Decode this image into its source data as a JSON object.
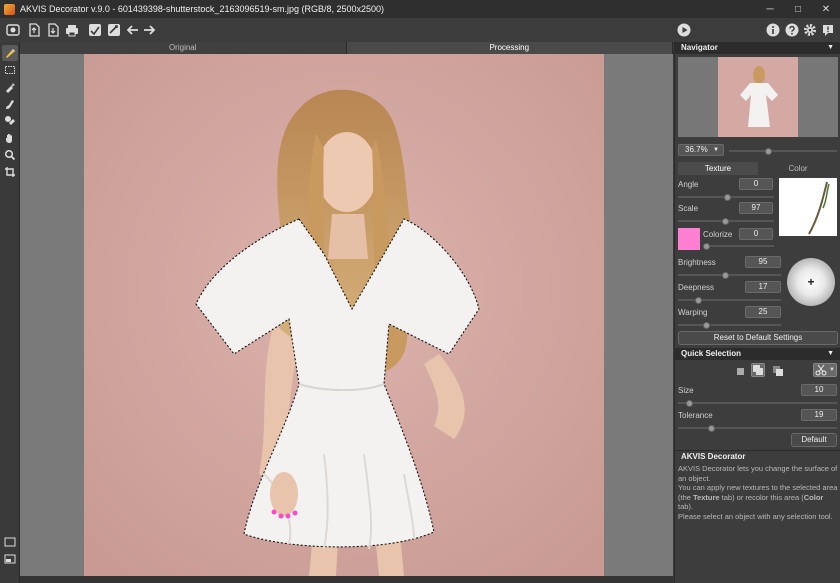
{
  "window": {
    "title": "AKVIS Decorator v.9.0 - 601439398-shutterstock_2163096519-sm.jpg (RGB/8, 2500x2500)",
    "controls": [
      "─",
      "□",
      "✕"
    ]
  },
  "view_tabs": [
    {
      "label": "Original",
      "active": false
    },
    {
      "label": "Processing",
      "active": true
    }
  ],
  "navigator": {
    "title": "Navigator",
    "zoom": "36.7%"
  },
  "texture_panel": {
    "tabs": [
      {
        "label": "Texture",
        "active": true
      },
      {
        "label": "Color",
        "active": false
      }
    ],
    "angle_label": "Angle",
    "angle_value": "0",
    "scale_label": "Scale",
    "scale_value": "97",
    "colorize_label": "Colorize",
    "colorize_value": "0",
    "colorize_color": "#ff7fd2",
    "brightness_label": "Brightness",
    "brightness_value": "95",
    "deepness_label": "Deepness",
    "deepness_value": "17",
    "warping_label": "Warping",
    "warping_value": "25",
    "reset_label": "Reset to Default Settings"
  },
  "quick_selection": {
    "title": "Quick Selection",
    "size_label": "Size",
    "size_value": "10",
    "tolerance_label": "Tolerance",
    "tolerance_value": "19",
    "default_label": "Default"
  },
  "info": {
    "title": "AKVIS Decorator",
    "line1": "AKVIS Decorator lets you change the surface of an object.",
    "line2_a": "You can apply new textures to the selected area (the ",
    "line2_b": "Texture",
    "line2_c": " tab) or recolor this area (",
    "line2_d": "Color",
    "line2_e": " tab).",
    "line3": "Please select an object with any selection tool."
  },
  "colors": {
    "background": "#d4a9a3",
    "accent_pink": "#ff7fd2"
  }
}
